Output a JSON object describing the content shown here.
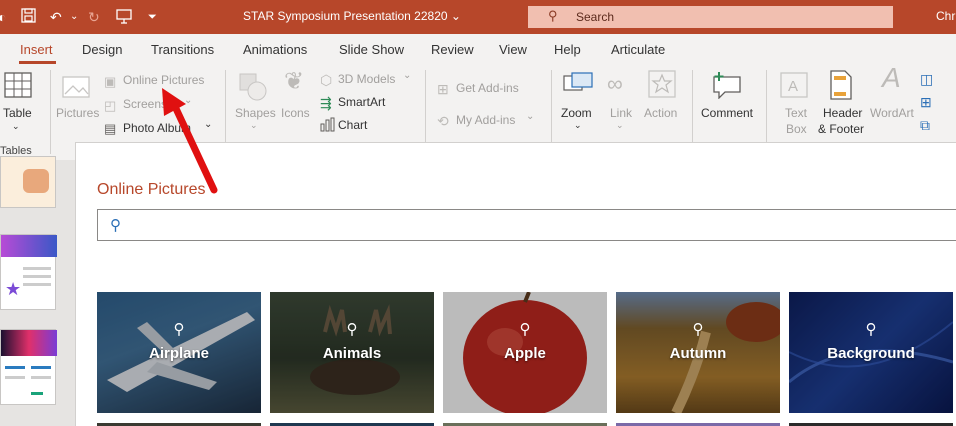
{
  "titlebar": {
    "title": "STAR Symposium Presentation 22820",
    "title_caret": "⌄",
    "search_placeholder": "Search",
    "user": "Chr",
    "icons": [
      "autosave-icon",
      "save-icon",
      "undo-icon",
      "redo-icon",
      "present-icon",
      "customize-icon"
    ]
  },
  "tabs": [
    {
      "label": "Insert",
      "active": true
    },
    {
      "label": "Design"
    },
    {
      "label": "Transitions"
    },
    {
      "label": "Animations"
    },
    {
      "label": "Slide Show"
    },
    {
      "label": "Review"
    },
    {
      "label": "View"
    },
    {
      "label": "Help"
    },
    {
      "label": "Articulate"
    }
  ],
  "ribbon": {
    "table": "Table",
    "tables_group": "Tables",
    "pictures": "Pictures",
    "online_pictures": "Online Pictures",
    "screenshot": "Screensh",
    "photo_album": "Photo Album",
    "shapes": "Shapes",
    "icons": "Icons",
    "models_3d": "3D Models",
    "smartart": "SmartArt",
    "chart": "Chart",
    "get_addins": "Get Add-ins",
    "my_addins": "My Add-ins",
    "zoom": "Zoom",
    "link": "Link",
    "action": "Action",
    "comment": "Comment",
    "text_box_1": "Text",
    "text_box_2": "Box",
    "header_1": "Header",
    "header_2": "& Footer",
    "wordart": "WordArt"
  },
  "dialog": {
    "title": "Online Pictures",
    "search_value": "",
    "categories": [
      "Airplane",
      "Animals",
      "Apple",
      "Autumn",
      "Background"
    ]
  },
  "colors": {
    "accent": "#b7472a",
    "search_icon": "#2b6fb6"
  }
}
